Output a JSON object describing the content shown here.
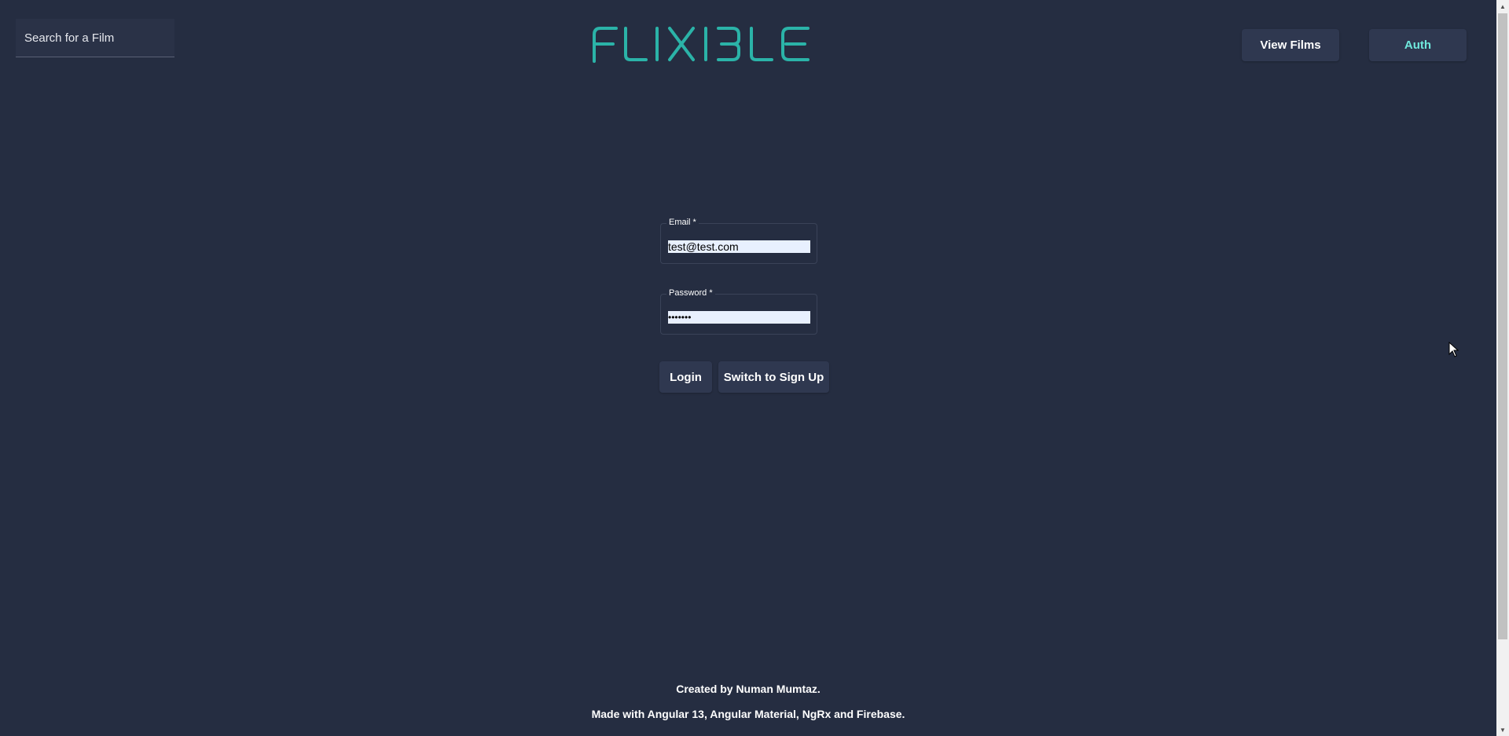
{
  "header": {
    "search": {
      "placeholder": "Search for a Film",
      "value": ""
    },
    "logo": {
      "text": "FLIXIBLE",
      "color": "#2bb3a8"
    },
    "nav": {
      "view_films_label": "View Films",
      "auth_label": "Auth",
      "active_color": "#6fe8dc"
    }
  },
  "form": {
    "email": {
      "label": "Email *",
      "value": "test@test.com"
    },
    "password": {
      "label": "Password *",
      "value": "•••••••"
    },
    "login_label": "Login",
    "switch_label": "Switch to Sign Up"
  },
  "footer": {
    "line1": "Created by Numan Mumtaz.",
    "line2": "Made with Angular 13, Angular Material, NgRx and Firebase."
  },
  "colors": {
    "background": "#252d41",
    "button": "#2f3850"
  }
}
